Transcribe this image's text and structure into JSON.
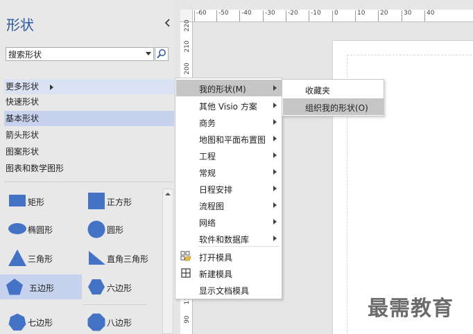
{
  "colors": {
    "accent": "#2b579a",
    "shape_fill": "#4472c4",
    "selected": "#c7d3ee",
    "menu_highlight": "#c6c6c6"
  },
  "shapes_pane": {
    "title": "形状",
    "search": {
      "value": "搜索形状",
      "placeholder": "搜索形状"
    },
    "stencils": [
      {
        "label": "更多形状",
        "state": "hover",
        "has_submenu": true
      },
      {
        "label": "快速形状"
      },
      {
        "label": "基本形状",
        "state": "selected"
      },
      {
        "label": "箭头形状"
      },
      {
        "label": "图案形状"
      },
      {
        "label": "图表和数学图形"
      }
    ],
    "masters": [
      {
        "label": "矩形",
        "icon": "rectangle"
      },
      {
        "label": "正方形",
        "icon": "square"
      },
      {
        "label": "椭圆形",
        "icon": "ellipse"
      },
      {
        "label": "圆形",
        "icon": "circle"
      },
      {
        "label": "三角形",
        "icon": "triangle"
      },
      {
        "label": "直角三角形",
        "icon": "right-triangle"
      },
      {
        "label": "五边形",
        "icon": "pentagon",
        "state": "selected"
      },
      {
        "label": "六边形",
        "icon": "hexagon"
      },
      {
        "label": "七边形",
        "icon": "heptagon"
      },
      {
        "label": "八边形",
        "icon": "octagon"
      }
    ]
  },
  "ruler": {
    "top_ticks": [
      "-60",
      "-50",
      "-40",
      "-30",
      "-20",
      "-10",
      "0",
      "10",
      "20",
      "30",
      "40"
    ],
    "left_ticks": [
      "220",
      "210",
      "200",
      "110",
      "90"
    ]
  },
  "context_menu": {
    "items": [
      {
        "label": "我的形状(M)",
        "has_submenu": true,
        "state": "highlighted"
      },
      {
        "label": "其他 Visio 方案",
        "has_submenu": true
      },
      {
        "label": "商务",
        "has_submenu": true
      },
      {
        "label": "地图和平面布置图",
        "has_submenu": true
      },
      {
        "label": "工程",
        "has_submenu": true
      },
      {
        "label": "常规",
        "has_submenu": true
      },
      {
        "label": "日程安排",
        "has_submenu": true
      },
      {
        "label": "流程图",
        "has_submenu": true
      },
      {
        "label": "网络",
        "has_submenu": true
      },
      {
        "label": "软件和数据库",
        "has_submenu": true
      },
      {
        "label": "打开模具",
        "icon": "open-stencil"
      },
      {
        "label": "新建模具",
        "icon": "new-stencil"
      },
      {
        "label": "显示文档模具"
      }
    ]
  },
  "submenu": {
    "items": [
      {
        "label": "收藏夹"
      },
      {
        "label": "组织我的形状(O)",
        "state": "highlighted"
      }
    ]
  },
  "watermark": "最需教育"
}
